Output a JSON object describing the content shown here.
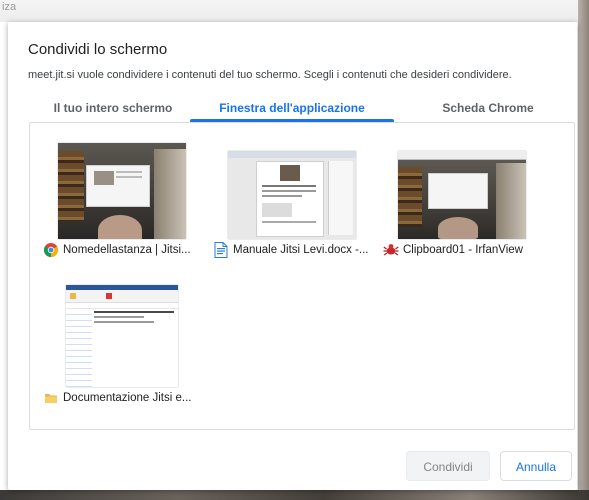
{
  "background": {
    "top_text": "iza"
  },
  "dialog": {
    "title": "Condividi lo schermo",
    "subtitle": "meet.jit.si vuole condividere i contenuti del tuo schermo. Scegli i contenuti che desideri condividere.",
    "tabs": [
      {
        "label": "Il tuo intero schermo",
        "active": false
      },
      {
        "label": "Finestra dell'applicazione",
        "active": true
      },
      {
        "label": "Scheda Chrome",
        "active": false
      }
    ],
    "windows": [
      {
        "label": "Nomedellastanza | Jitsi...",
        "icon": "chrome-icon"
      },
      {
        "label": "Manuale Jitsi Levi.docx -...",
        "icon": "writer-document-icon"
      },
      {
        "label": "Clipboard01 - IrfanView",
        "icon": "irfanview-icon"
      },
      {
        "label": "Documentazione Jitsi e...",
        "icon": "folder-icon"
      }
    ],
    "buttons": {
      "share": "Condividi",
      "cancel": "Annulla"
    }
  },
  "colors": {
    "accent": "#1a73e8",
    "tab_inactive": "#5f6368",
    "share_disabled_bg": "#f1f3f4"
  }
}
